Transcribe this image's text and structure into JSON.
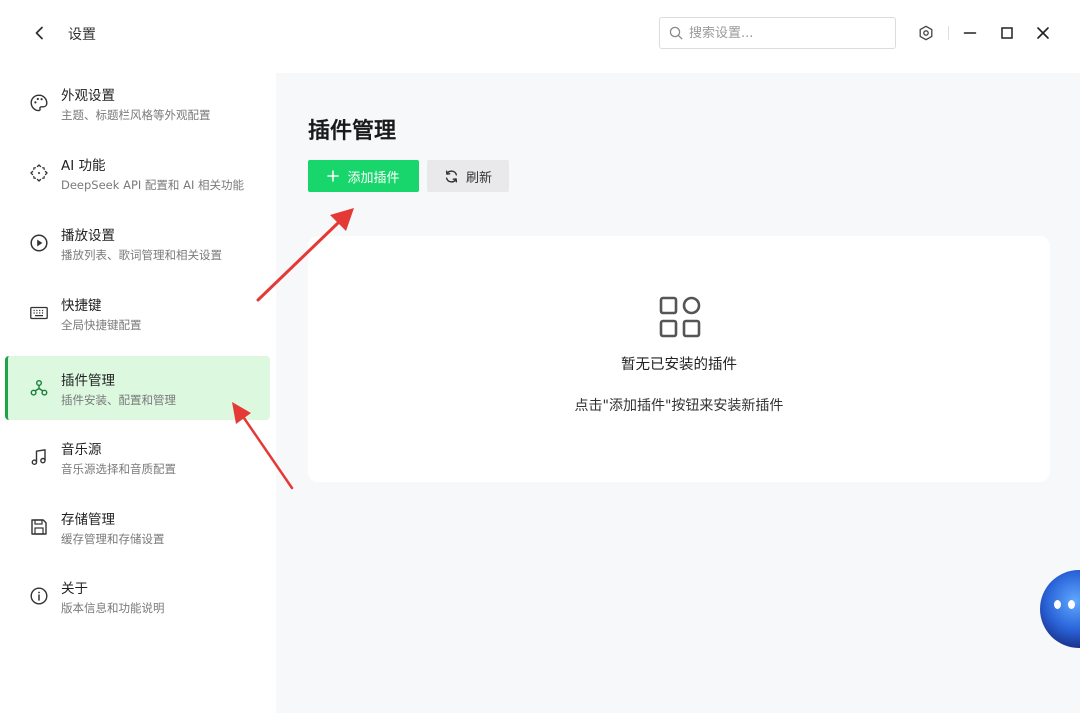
{
  "window": {
    "title": "设置",
    "search_placeholder": "搜索设置...",
    "icons": {
      "back": "chevron-left-icon",
      "search": "search-icon",
      "theme": "settings-icon",
      "minimize": "minimize-icon",
      "maximize": "maximize-icon",
      "close": "close-icon"
    }
  },
  "sidebar": {
    "items": [
      {
        "title": "外观设置",
        "subtitle": "主题、标题栏风格等外观配置",
        "icon": "palette-icon",
        "active": false
      },
      {
        "title": "AI 功能",
        "subtitle": "DeepSeek API 配置和 AI 相关功能",
        "icon": "ai-icon",
        "active": false
      },
      {
        "title": "播放设置",
        "subtitle": "播放列表、歌词管理和相关设置",
        "icon": "play-circle-icon",
        "active": false
      },
      {
        "title": "快捷键",
        "subtitle": "全局快捷键配置",
        "icon": "keyboard-icon",
        "active": false
      },
      {
        "title": "插件管理",
        "subtitle": "插件安装、配置和管理",
        "icon": "plugin-icon",
        "active": true
      },
      {
        "title": "音乐源",
        "subtitle": "音乐源选择和音质配置",
        "icon": "music-note-icon",
        "active": false
      },
      {
        "title": "存储管理",
        "subtitle": "缓存管理和存储设置",
        "icon": "save-icon",
        "active": false
      },
      {
        "title": "关于",
        "subtitle": "版本信息和功能说明",
        "icon": "info-icon",
        "active": false
      }
    ],
    "active_color": "#1fa347",
    "active_bg": "#dcf8df"
  },
  "main": {
    "title": "插件管理",
    "add_button": "添加插件",
    "refresh_button": "刷新",
    "empty_state": {
      "icon": "apps-grid-icon",
      "title": "暂无已安装的插件",
      "hint": "点击\"添加插件\"按钮来安装新插件"
    }
  },
  "colors": {
    "primary_green": "#18d66b",
    "annotation_red": "#e53935"
  }
}
